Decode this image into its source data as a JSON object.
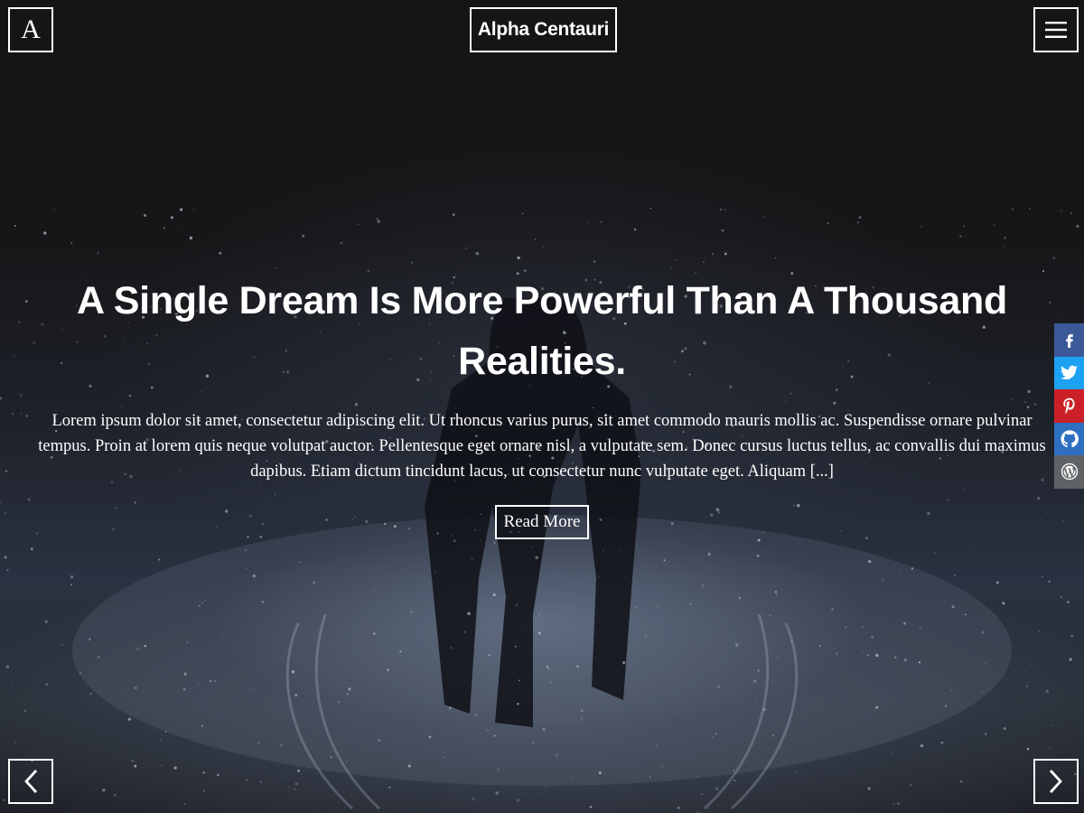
{
  "header": {
    "logo_letter": "A",
    "site_title": "Alpha Centauri"
  },
  "hero": {
    "title": "A Single Dream Is More Powerful Than A Thousand Realities.",
    "excerpt": "Lorem ipsum dolor sit amet, consectetur adipiscing elit. Ut rhoncus varius purus, sit amet commodo mauris mollis ac. Suspendisse ornare pulvinar tempus. Proin at lorem quis neque volutpat auctor. Pellentesque eget ornare nisl, a vulputate sem. Donec cursus luctus tellus, ac convallis dui maximus dapibus. Etiam dictum tincidunt lacus, ut consectetur nunc vulputate eget. Aliquam [...]",
    "read_more_label": "Read More"
  },
  "social": [
    {
      "name": "facebook",
      "icon": "facebook-icon",
      "color": "#3b5998"
    },
    {
      "name": "twitter",
      "icon": "twitter-icon",
      "color": "#1da1f2"
    },
    {
      "name": "pinterest",
      "icon": "pinterest-icon",
      "color": "#cb2027"
    },
    {
      "name": "github",
      "icon": "github-icon",
      "color": "#2e6fc0"
    },
    {
      "name": "wordpress",
      "icon": "wordpress-icon",
      "color": "#5f6366"
    }
  ],
  "navigation": {
    "menu_icon": "hamburger-menu-icon",
    "prev_icon": "chevron-left-icon",
    "next_icon": "chevron-right-icon"
  }
}
